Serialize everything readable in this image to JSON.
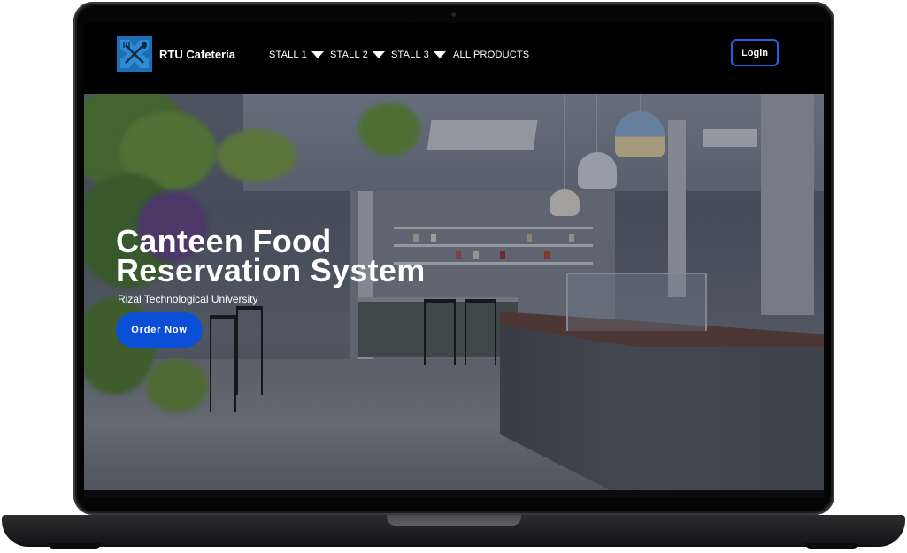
{
  "navbar": {
    "brand": "RTU Cafeteria",
    "logo_icon": "utensils-cross-icon",
    "items": [
      {
        "label": "STALL 1",
        "has_dropdown": true
      },
      {
        "label": "STALL 2",
        "has_dropdown": true
      },
      {
        "label": "STALL 3",
        "has_dropdown": true
      },
      {
        "label": "ALL PRODUCTS",
        "has_dropdown": false
      }
    ],
    "login_label": "Login"
  },
  "hero": {
    "title_line1": "Canteen Food",
    "title_line2": "Reservation System",
    "subtitle": "Rizal Technological University",
    "cta_label": "Order Now",
    "background": "cafeteria-interior-photo"
  },
  "colors": {
    "navbar_bg": "#000000",
    "accent_blue": "#0b4fd6",
    "login_border": "#1d63e8",
    "logo_blue": "#1d6fb5"
  }
}
